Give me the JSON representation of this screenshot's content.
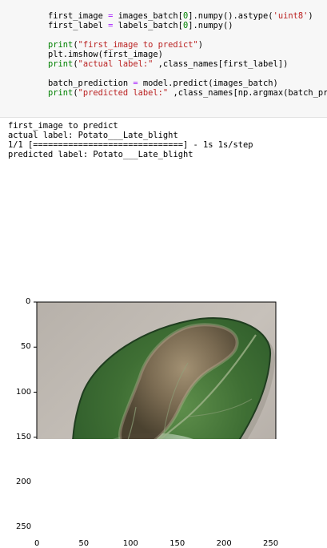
{
  "code_lines": [
    "    first_image = images_batch[0].numpy().astype('uint8')",
    "    first_label = labels_batch[0].numpy()",
    "",
    "    print(\"first_image to predict\")",
    "    plt.imshow(first_image)",
    "    print(\"actual label:\" ,class_names[first_label])",
    "",
    "    batch_prediction = model.predict(images_batch)",
    "    print(\"predicted label:\" ,class_names[np.argmax(batch_predict"
  ],
  "output_lines": [
    "first_image to predict",
    "actual label: Potato___Late_blight",
    "1/1 [==============================] - 1s 1s/step",
    "predicted label: Potato___Late_blight"
  ],
  "chart": {
    "type": "image",
    "x_ticks": [
      "0",
      "50",
      "100",
      "150",
      "200",
      "250"
    ],
    "y_ticks": [
      "0",
      "50",
      "100",
      "150",
      "200",
      "250"
    ],
    "xlim": [
      0,
      256
    ],
    "ylim": [
      256,
      0
    ]
  },
  "image_subject": "potato leaf with late blight lesion",
  "colors": {
    "background": "#ffffff",
    "code_bg": "#f7f7f7",
    "string": "#ba2121",
    "keyword": "#008000"
  }
}
